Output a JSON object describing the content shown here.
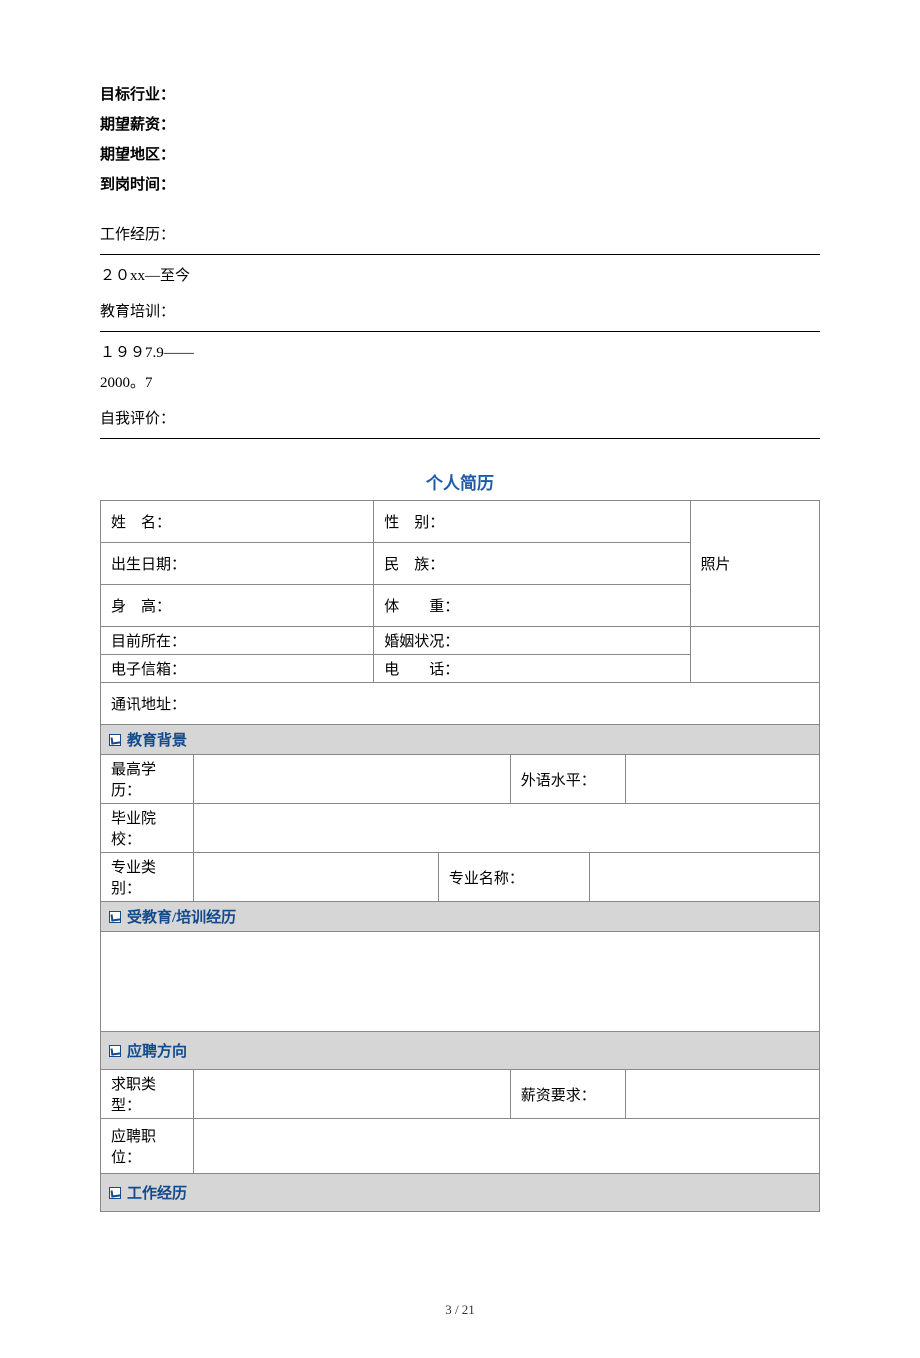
{
  "topFields": {
    "targetIndustry": "目标行业：",
    "expectedSalary": "期望薪资：",
    "expectedLocation": "期望地区：",
    "startTime": "到岗时间："
  },
  "workExp": {
    "label": "工作经历：",
    "period": "２０xx—至今"
  },
  "eduTraining": {
    "label": "教育培训：",
    "period1": "１９９7.9——",
    "period2": "2000。7"
  },
  "selfEval": {
    "label": "自我评价："
  },
  "resumeTitle": "个人简历",
  "basicInfo": {
    "name": "姓　名：",
    "gender": "性　别：",
    "birthDate": "出生日期：",
    "ethnicity": "民　族：",
    "height": "身　高：",
    "weight": "体　　重：",
    "currentLocation": "目前所在：",
    "maritalStatus": "婚姻状况：",
    "email": "电子信箱：",
    "phone": "电　　话：",
    "address": "通讯地址：",
    "photo": "照片"
  },
  "sections": {
    "eduBackground": "教育背景",
    "eduTrainingHistory": "受教育/培训经历",
    "jobDirection": "应聘方向",
    "workHistory": "工作经历"
  },
  "edu": {
    "highestDegree": "最高学历：",
    "languageLevel": "外语水平：",
    "graduateSchool": "毕业院校：",
    "majorCategory": "专业类别：",
    "majorName": "专业名称："
  },
  "job": {
    "jobType": "求职类型：",
    "salaryReq": "薪资要求：",
    "position": "应聘职位："
  },
  "footer": "3 / 21"
}
